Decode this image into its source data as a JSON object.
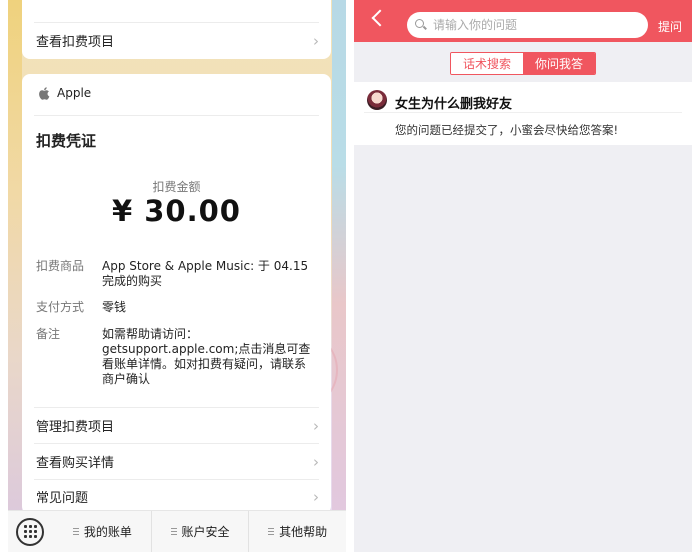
{
  "left_panel": {
    "top_card": {
      "view_item_label": "查看扣费项目"
    },
    "receipt": {
      "brand": "Apple",
      "title": "扣费凭证",
      "amount_label": "扣费金额",
      "amount": "¥ 30.00",
      "details": [
        {
          "key": "扣费商品",
          "value": "App Store & Apple Music: 于 04.15完成的购买"
        },
        {
          "key": "支付方式",
          "value": "零钱"
        },
        {
          "key": "备注",
          "value": "如需帮助请访问：getsupport.apple.com;点击消息可查看账单详情。如对扣费有疑问，请联系商户确认"
        }
      ],
      "links": [
        "管理扣费项目",
        "查看购买详情",
        "常见问题"
      ]
    },
    "tabbar": {
      "keyboard_icon": "keyboard-icon",
      "items": [
        "我的账单",
        "账户安全",
        "其他帮助"
      ]
    }
  },
  "right_panel": {
    "header": {
      "search_placeholder": "请输入你的问题",
      "ask_label": "提问",
      "back_icon": "chevron-left-icon"
    },
    "segments": {
      "search_tab": "话术搜索",
      "ask_tab": "你问我答",
      "active": "你问我答"
    },
    "question": {
      "title": "女生为什么删我好友",
      "status": "您的问题已经提交了，小蜜会尽快给您答案!"
    }
  },
  "colors": {
    "accent_red": "#f0565f",
    "text_primary": "#222222",
    "text_secondary": "#777777"
  }
}
